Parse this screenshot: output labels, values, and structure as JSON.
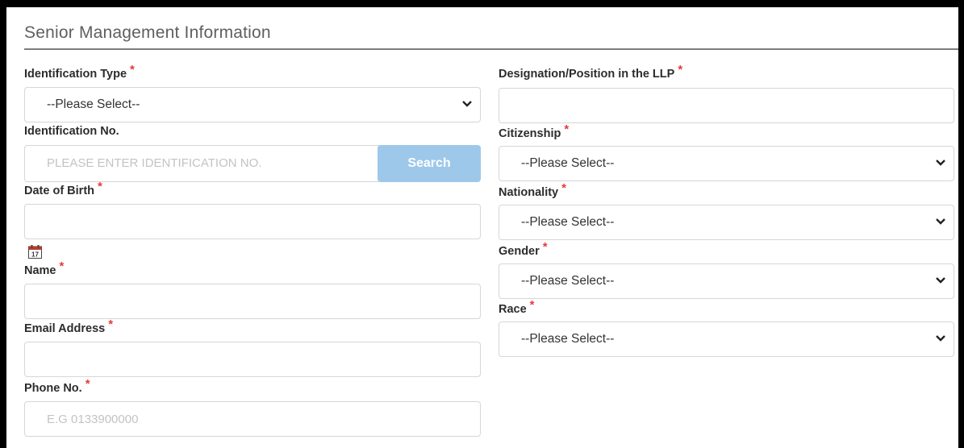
{
  "section": {
    "title": "Senior Management Information"
  },
  "required_marker": "*",
  "left": {
    "identification_type": {
      "label": "Identification Type",
      "value": "--Please Select--"
    },
    "identification_no": {
      "label": "Identification No.",
      "placeholder": "PLEASE ENTER IDENTIFICATION NO.",
      "search_label": "Search"
    },
    "date_of_birth": {
      "label": "Date of Birth",
      "value": ""
    },
    "name": {
      "label": "Name",
      "value": ""
    },
    "email": {
      "label": "Email Address",
      "value": ""
    },
    "phone": {
      "label": "Phone No.",
      "placeholder": "E.G 0133900000"
    }
  },
  "right": {
    "designation": {
      "label": "Designation/Position in the LLP",
      "value": ""
    },
    "citizenship": {
      "label": "Citizenship",
      "value": "--Please Select--"
    },
    "nationality": {
      "label": "Nationality",
      "value": "--Please Select--"
    },
    "gender": {
      "label": "Gender",
      "value": "--Please Select--"
    },
    "race": {
      "label": "Race",
      "value": "--Please Select--"
    }
  },
  "icons": {
    "calendar": "calendar-icon",
    "chevron": "chevron-down-icon"
  },
  "colors": {
    "required": "#e23c3c",
    "search_button": "#9ec8ea",
    "border": "#d6d6d6"
  }
}
